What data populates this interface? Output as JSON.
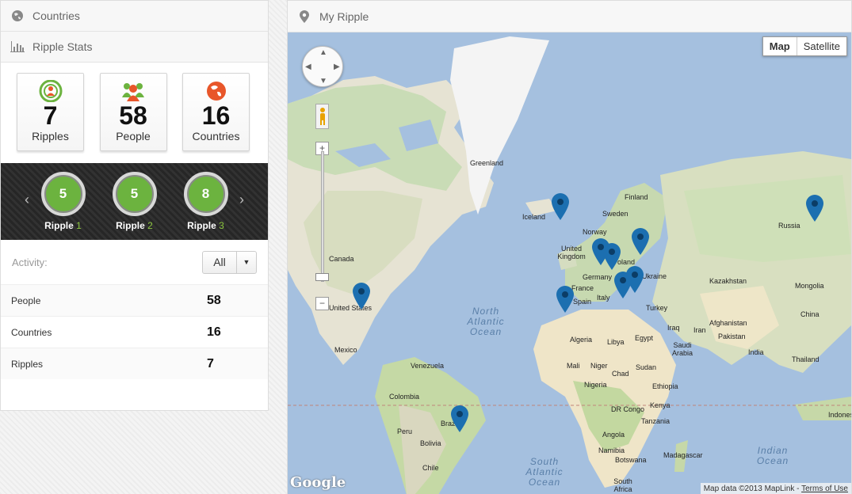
{
  "left": {
    "countries_title": "Countries",
    "stats_title": "Ripple Stats",
    "stats": [
      {
        "value": "7",
        "label": "Ripples",
        "icon": "ripple-icon"
      },
      {
        "value": "58",
        "label": "People",
        "icon": "people-icon"
      },
      {
        "value": "16",
        "label": "Countries",
        "icon": "globe-icon"
      }
    ],
    "ripples": [
      {
        "value": "5",
        "label": "Ripple",
        "num": "1"
      },
      {
        "value": "5",
        "label": "Ripple",
        "num": "2"
      },
      {
        "value": "8",
        "label": "Ripple",
        "num": "3"
      }
    ],
    "activity_label": "Activity:",
    "activity_value": "All",
    "rows": [
      {
        "key": "People",
        "value": "58"
      },
      {
        "key": "Countries",
        "value": "16"
      },
      {
        "key": "Ripples",
        "value": "7"
      }
    ]
  },
  "right": {
    "title": "My Ripple",
    "map_type": {
      "map": "Map",
      "satellite": "Satellite"
    },
    "zoom_in": "+",
    "zoom_out": "−",
    "google": "Google",
    "attribution": "Map data ©2013 MapLink - ",
    "terms": "Terms of Use",
    "labels": [
      "Greenland",
      "Iceland",
      "Finland",
      "Sweden",
      "Norway",
      "United Kingdom",
      "Poland",
      "Germany",
      "Ukraine",
      "France",
      "Italy",
      "Spain",
      "Turkey",
      "Russia",
      "Kazakhstan",
      "Mongolia",
      "China",
      "India",
      "Thailand",
      "Afghanistan",
      "Pakistan",
      "Iran",
      "Iraq",
      "Saudi Arabia",
      "Egypt",
      "Libya",
      "Algeria",
      "Mali",
      "Niger",
      "Chad",
      "Sudan",
      "Nigeria",
      "Ethiopia",
      "Kenya",
      "Tanzania",
      "DR Congo",
      "Angola",
      "Namibia",
      "Botswana",
      "Madagascar",
      "South Africa",
      "Canada",
      "United States",
      "Mexico",
      "Venezuela",
      "Colombia",
      "Peru",
      "Bolivia",
      "Brazil",
      "Chile",
      "Indones"
    ],
    "oceans": [
      "North Atlantic Ocean",
      "South Atlantic Ocean",
      "Indian Ocean"
    ]
  }
}
